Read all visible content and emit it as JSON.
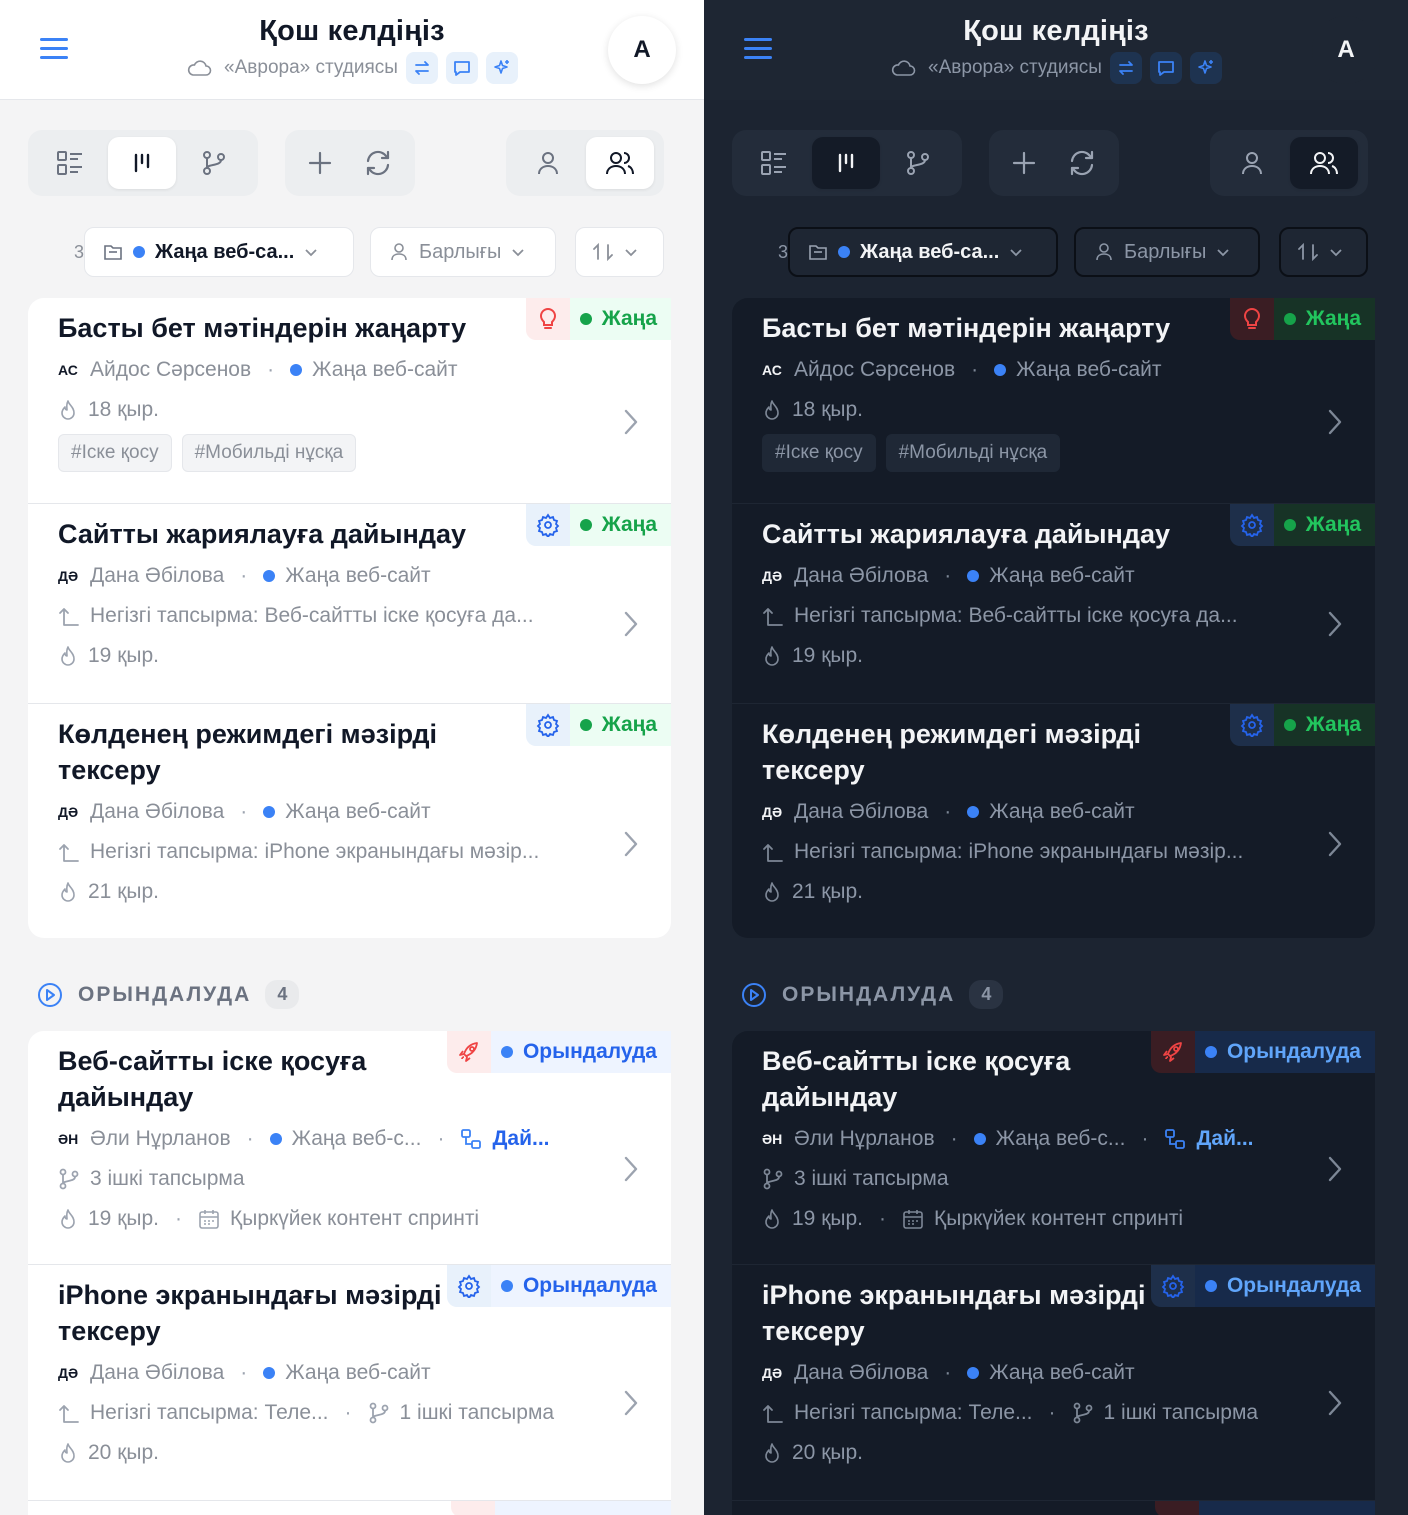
{
  "header": {
    "title": "Қош келдіңіз",
    "studio": "«Аврора» студиясы",
    "avatar_letter": "A"
  },
  "filters": {
    "count_prefix": "3",
    "project": "Жаңа веб-са...",
    "assignee": "Барлығы"
  },
  "section_new": {
    "cards": [
      {
        "title": "Басты бет мәтіндерін жаңарту",
        "icon": "bulb-icon",
        "status": "Жаңа",
        "initials": "АС",
        "person": "Айдос Сәрсенов",
        "project": "Жаңа веб-сайт",
        "due": "18 қыр.",
        "tags": [
          "#Іске қосу",
          "#Мобильді нұсқа"
        ]
      },
      {
        "title": "Сайтты жариялауға дайындау",
        "icon": "gear-icon",
        "status": "Жаңа",
        "initials": "ДӘ",
        "person": "Дана Әбілова",
        "project": "Жаңа веб-сайт",
        "parent": "Негізгі тапсырма: Веб-сайтты іске қосуға да...",
        "due": "19 қыр."
      },
      {
        "title_line1": "Көлденең режимдегі мәзірді",
        "title_line2": "тексеру",
        "icon": "gear-icon",
        "status": "Жаңа",
        "initials": "ДӘ",
        "person": "Дана Әбілова",
        "project": "Жаңа веб-сайт",
        "parent": "Негізгі тапсырма: iPhone экранындағы мәзір...",
        "due": "21 қыр."
      }
    ]
  },
  "section_progress": {
    "label": "ОРЫНДАЛУДА",
    "count": "4",
    "cards": [
      {
        "title_line1": "Веб-сайтты іске қосуға",
        "title_line2": "дайындау",
        "icon": "rocket-icon",
        "status": "Орындалуда",
        "initials": "ӘН",
        "person": "Әли Нұрланов",
        "project": "Жаңа веб-с...",
        "linked": "Дай...",
        "subtasks": "3 ішкі тапсырма",
        "due": "19 қыр.",
        "sprint": "Қыркүйек контент спринті"
      },
      {
        "title_line1": "iPhone экранындағы мәзірді",
        "title_line2": "тексеру",
        "icon": "gear-icon",
        "status": "Орындалуда",
        "initials": "ДӘ",
        "person": "Дана Әбілова",
        "project": "Жаңа веб-сайт",
        "parent": "Негізгі тапсырма: Теле...",
        "subtasks": "1 ішкі тапсырма",
        "due": "20 қыр."
      }
    ]
  },
  "colors": {
    "accent": "#3b82f6",
    "status_new": "#16a34a",
    "status_progress": "#2563eb",
    "light_bg": "#f4f4f5",
    "dark_bg": "#1c2431"
  }
}
